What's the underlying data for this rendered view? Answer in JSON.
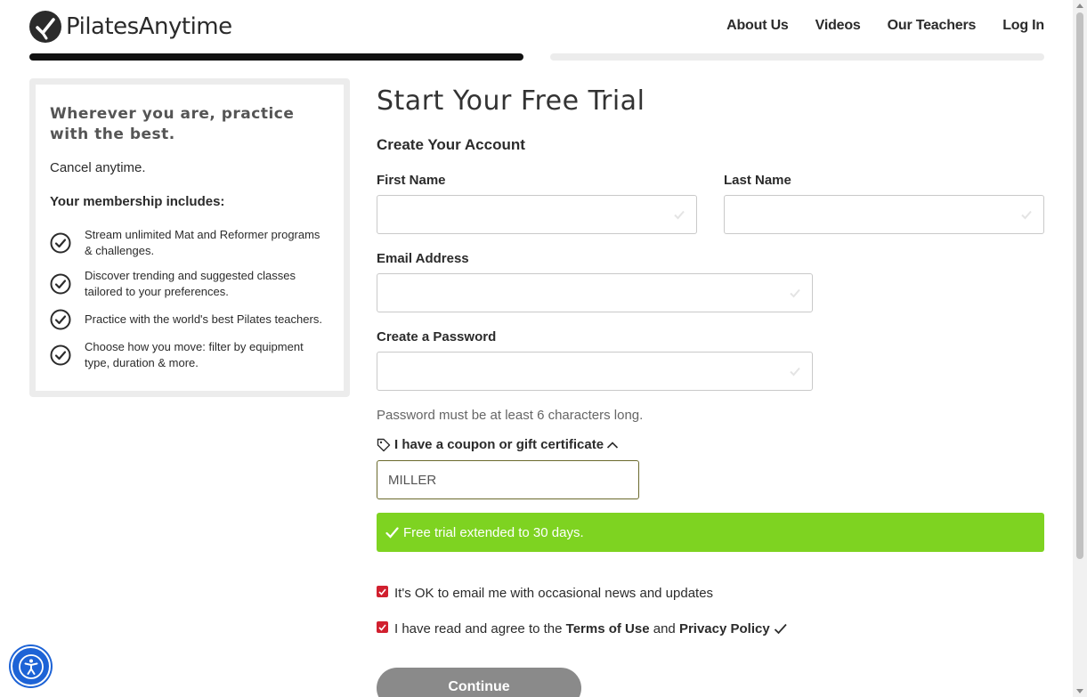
{
  "header": {
    "logo_text": "PilatesAnytime",
    "nav": [
      "About Us",
      "Videos",
      "Our Teachers",
      "Log In"
    ]
  },
  "progress": {
    "current_step": 1,
    "total_steps": 2
  },
  "promo": {
    "title": "Wherever you are, practice with the best.",
    "cancel": "Cancel anytime.",
    "includes": "Your membership includes:",
    "features": [
      "Stream unlimited Mat and Reformer programs & challenges.",
      "Discover trending and suggested classes tailored to your preferences.",
      "Practice with the world's best Pilates teachers.",
      "Choose how you move: filter by equipment type, duration & more."
    ]
  },
  "form": {
    "title": "Start Your Free Trial",
    "section": "Create Your Account",
    "first_name_label": "First Name",
    "last_name_label": "Last Name",
    "email_label": "Email Address",
    "password_label": "Create a Password",
    "password_hint": "Password must be at least 6 characters long.",
    "coupon_toggle": "I have a coupon or gift certificate",
    "coupon_value": "MILLER",
    "success_message": "Free trial extended to 30 days.",
    "email_optin": "It's OK to email me with occasional news and updates",
    "agree_prefix": "I have read and agree to the",
    "terms": "Terms of Use",
    "and": "and",
    "privacy": "Privacy Policy",
    "continue": "Continue"
  },
  "colors": {
    "success": "#7ed321",
    "checkbox": "#d1202f",
    "accessibility": "#1d63d6",
    "button_disabled": "#8a8a8a"
  }
}
